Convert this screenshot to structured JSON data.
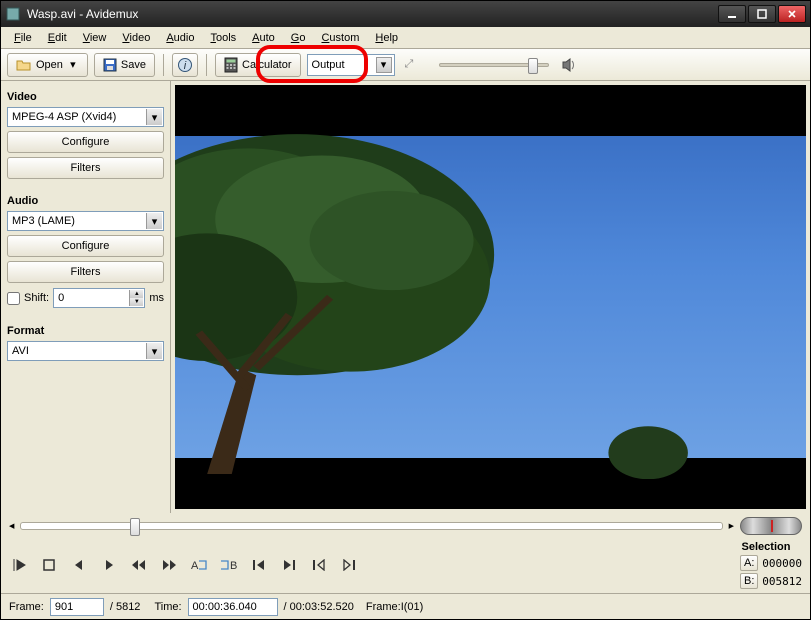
{
  "title": "Wasp.avi - Avidemux",
  "menu": {
    "file": "File",
    "edit": "Edit",
    "view": "View",
    "video": "Video",
    "audio": "Audio",
    "tools": "Tools",
    "auto": "Auto",
    "go": "Go",
    "custom": "Custom",
    "help": "Help"
  },
  "toolbar": {
    "open": "Open",
    "save": "Save",
    "calculator": "Calculator",
    "zoom": "Output"
  },
  "sidebar": {
    "video_label": "Video",
    "video_codec": "MPEG-4 ASP (Xvid4)",
    "configure": "Configure",
    "filters": "Filters",
    "audio_label": "Audio",
    "audio_codec": "MP3 (LAME)",
    "shift_label": "Shift:",
    "shift_value": "0",
    "shift_unit": "ms",
    "format_label": "Format",
    "format_value": "AVI"
  },
  "selection": {
    "label": "Selection",
    "a_label": "A:",
    "a_val": "000000",
    "b_label": "B:",
    "b_val": "005812"
  },
  "status": {
    "frame_label": "Frame:",
    "frame_value": "901",
    "frame_total": "/ 5812",
    "time_label": "Time:",
    "time_value": "00:00:36.040",
    "time_total": "/ 00:03:52.520",
    "frametype": "Frame:I(01)"
  }
}
